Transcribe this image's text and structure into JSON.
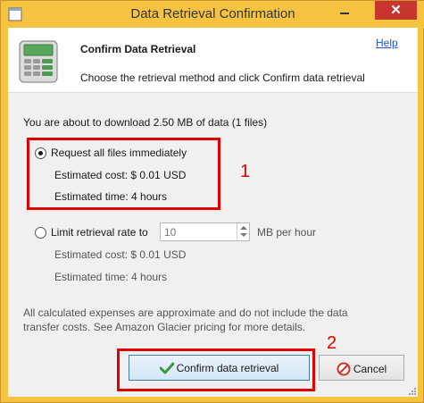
{
  "window": {
    "title": "Data Retrieval Confirmation"
  },
  "header": {
    "title": "Confirm Data Retrieval",
    "subtitle": "Choose the retrieval method and click Confirm data retrieval",
    "help_label": "Help"
  },
  "summary": "You are about to download 2.50 MB of data (1 files)",
  "option_immediate": {
    "label": "Request all files immediately",
    "selected": true,
    "cost": "Estimated cost: $ 0.01 USD",
    "time": "Estimated time: 4 hours"
  },
  "option_limit": {
    "label": "Limit retrieval rate to",
    "selected": false,
    "rate_value": "10",
    "rate_unit": "MB per hour",
    "cost": "Estimated cost: $ 0.01 USD",
    "time": "Estimated time: 4 hours"
  },
  "disclaimer_lines": [
    "All calculated expenses are approximate and do not include the data",
    "transfer costs. See Amazon Glacier pricing for more details."
  ],
  "buttons": {
    "confirm_label": "Confirm data retrieval",
    "cancel_label": "Cancel"
  },
  "annotations": {
    "first": "1",
    "second": "2"
  },
  "icons": {
    "app": "app-window-icon",
    "calculator": "calculator-icon",
    "confirm": "checkmark-icon",
    "cancel": "cancel-icon"
  },
  "colors": {
    "titlebar": "#f5c33f",
    "close_button": "#c7352e",
    "annotation": "#e00000",
    "link": "#1a56c9"
  }
}
